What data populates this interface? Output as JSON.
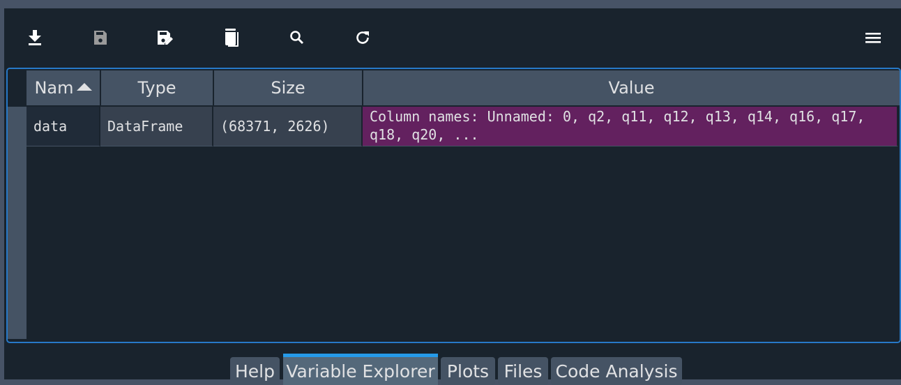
{
  "toolbar": {
    "buttons": [
      {
        "name": "import-data-button",
        "icon": "download-icon",
        "enabled": true
      },
      {
        "name": "save-data-button",
        "icon": "save-icon",
        "enabled": false
      },
      {
        "name": "save-data-as-button",
        "icon": "save-as-icon",
        "enabled": true
      },
      {
        "name": "remove-all-variables-button",
        "icon": "delete-icon",
        "enabled": true
      },
      {
        "name": "search-variables-button",
        "icon": "search-icon",
        "enabled": true
      },
      {
        "name": "refresh-variables-button",
        "icon": "refresh-icon",
        "enabled": true
      }
    ],
    "options_menu": {
      "icon": "hamburger-menu-icon"
    }
  },
  "table": {
    "columns": [
      {
        "label": "Nam",
        "sorted": "ascending"
      },
      {
        "label": "Type"
      },
      {
        "label": "Size"
      },
      {
        "label": "Value"
      }
    ],
    "rows": [
      {
        "name": "data",
        "type": "DataFrame",
        "size": "(68371, 2626)",
        "value": "Column names: Unnamed: 0, q2, q11, q12, q13, q14, q16, q17, q18, q20, ..."
      }
    ]
  },
  "tabs": [
    {
      "label": "Help",
      "active": false
    },
    {
      "label": "Variable Explorer",
      "active": true
    },
    {
      "label": "Plots",
      "active": false
    },
    {
      "label": "Files",
      "active": false
    },
    {
      "label": "Code Analysis",
      "active": false
    }
  ],
  "colors": {
    "accent": "#2779c8",
    "active_tab": "#259ae9",
    "value_highlight": "#63215f",
    "background": "#19232d"
  }
}
